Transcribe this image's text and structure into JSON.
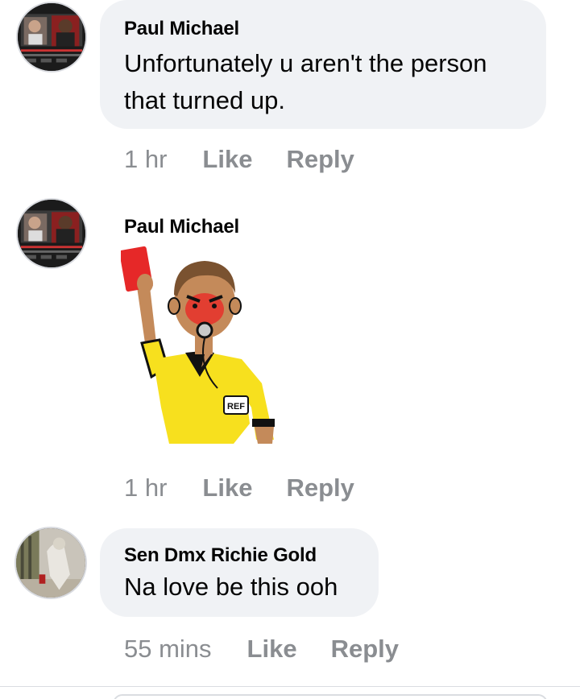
{
  "comments": [
    {
      "author": "Paul Michael",
      "text_lines": [
        "Unfortunately u aren't the person",
        "that turned up."
      ],
      "time": "1 hr",
      "like_label": "Like",
      "reply_label": "Reply"
    },
    {
      "author": "Paul Michael",
      "sticker_text": "REF",
      "time": "1 hr",
      "like_label": "Like",
      "reply_label": "Reply"
    },
    {
      "author": "Sen Dmx Richie Gold",
      "text_lines": [
        "Na love be this ooh"
      ],
      "time": "55 mins",
      "like_label": "Like",
      "reply_label": "Reply"
    }
  ],
  "icons": {
    "sticker": "referee-red-card-icon",
    "avatar_1": "avatar-video-thumbnail",
    "avatar_3": "avatar-photo"
  },
  "colors": {
    "bubble": "#f0f2f5",
    "meta_text": "#8a8d91",
    "jersey": "#f7e01e",
    "red_card": "#e62828"
  }
}
